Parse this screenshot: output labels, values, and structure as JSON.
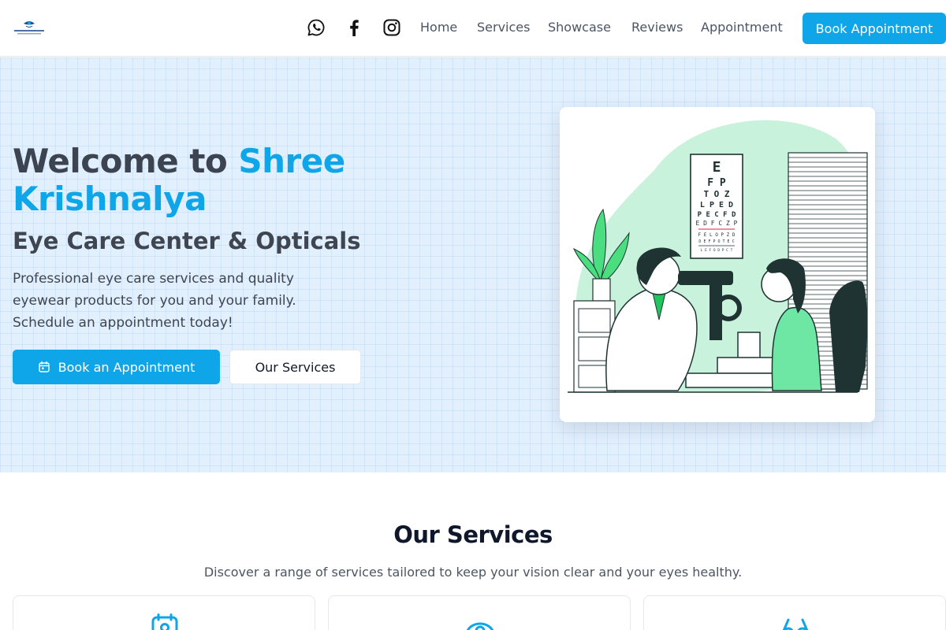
{
  "brand": {
    "logo_text": "SHREE KRISHNALYA",
    "logo_icon": "eye-logo-icon"
  },
  "header": {
    "social": [
      {
        "name": "whatsapp",
        "icon": "whatsapp-icon"
      },
      {
        "name": "facebook",
        "icon": "facebook-icon"
      },
      {
        "name": "instagram",
        "icon": "instagram-icon"
      }
    ],
    "nav": [
      "Home",
      "Services",
      "Showcase",
      "Reviews",
      "Appointment"
    ],
    "cta_label": "Book Appointment"
  },
  "hero": {
    "title_part1": "Welcome to",
    "title_part2": "Shree Krishnalya",
    "subtitle": "Eye Care Center & Opticals",
    "description": "Professional eye care services and quality eyewear products for you and your family. Schedule an appointment today!",
    "primary_button": "Book an Appointment",
    "primary_icon": "calendar-icon",
    "secondary_button": "Our Services",
    "illustration": "eye-exam-illustration",
    "eye_chart": [
      "E",
      "F P",
      "T O Z",
      "L P E D",
      "P E C F D",
      "E D F C Z P",
      "F E L O P Z D",
      "D E F P O T E C",
      "L E F O D P C T"
    ]
  },
  "services": {
    "title": "Our Services",
    "description": "Discover a range of services tailored to keep your vision clear and your eyes healthy.",
    "cards": [
      {
        "icon": "calendar-icon"
      },
      {
        "icon": "eye-icon"
      },
      {
        "icon": "glasses-icon"
      }
    ]
  },
  "colors": {
    "accent": "#0ea5e9",
    "heading": "#3d4451",
    "hero_bg": "#e2effd",
    "illustration_green": "#c9f2dc",
    "illustration_dark": "#1f3333"
  }
}
